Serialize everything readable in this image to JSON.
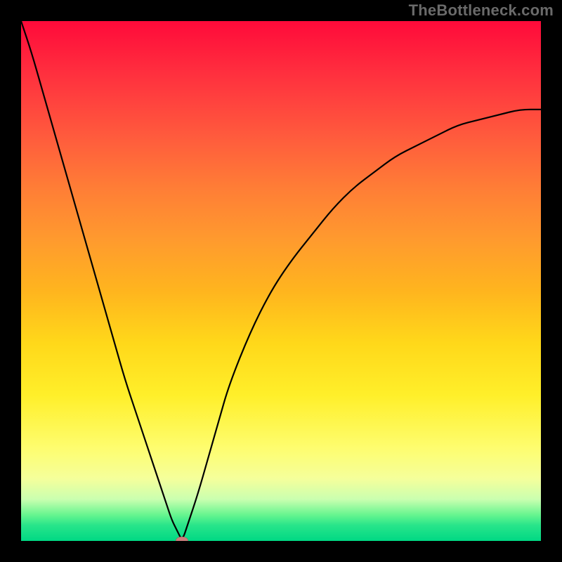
{
  "watermark": "TheBottleneck.com",
  "chart_data": {
    "type": "line",
    "title": "",
    "xlabel": "",
    "ylabel": "",
    "xlim": [
      0,
      100
    ],
    "ylim": [
      0,
      100
    ],
    "grid": false,
    "legend": false,
    "annotations": [],
    "series": [
      {
        "name": "bottleneck-curve",
        "x": [
          0,
          2,
          4,
          6,
          8,
          10,
          12,
          14,
          16,
          18,
          20,
          22,
          24,
          26,
          28,
          29,
          30,
          31,
          32,
          34,
          36,
          38,
          40,
          44,
          48,
          52,
          56,
          60,
          64,
          68,
          72,
          76,
          80,
          84,
          88,
          92,
          96,
          100
        ],
        "values": [
          100,
          94,
          87,
          80,
          73,
          66,
          59,
          52,
          45,
          38,
          31,
          25,
          19,
          13,
          7,
          4,
          2,
          0,
          3,
          9,
          16,
          23,
          30,
          40,
          48,
          54,
          59,
          64,
          68,
          71,
          74,
          76,
          78,
          80,
          81,
          82,
          83,
          83
        ]
      }
    ],
    "marker": {
      "x": 31,
      "y": 0
    },
    "background_gradient": {
      "direction": "vertical",
      "stops": [
        {
          "pos": 0,
          "color": "#ff0a3a"
        },
        {
          "pos": 10,
          "color": "#ff2f3e"
        },
        {
          "pos": 22,
          "color": "#ff5a3d"
        },
        {
          "pos": 32,
          "color": "#ff7d36"
        },
        {
          "pos": 42,
          "color": "#ff9a2e"
        },
        {
          "pos": 52,
          "color": "#ffb51e"
        },
        {
          "pos": 62,
          "color": "#ffd81a"
        },
        {
          "pos": 72,
          "color": "#ffef2a"
        },
        {
          "pos": 82,
          "color": "#fefd6e"
        },
        {
          "pos": 88,
          "color": "#f5ff9b"
        },
        {
          "pos": 92,
          "color": "#caffb0"
        },
        {
          "pos": 95,
          "color": "#66f58f"
        },
        {
          "pos": 97,
          "color": "#28e58a"
        },
        {
          "pos": 100,
          "color": "#00d884"
        }
      ]
    },
    "colors": {
      "curve": "#000000",
      "marker": "#cc7d7c",
      "frame": "#000000"
    }
  }
}
